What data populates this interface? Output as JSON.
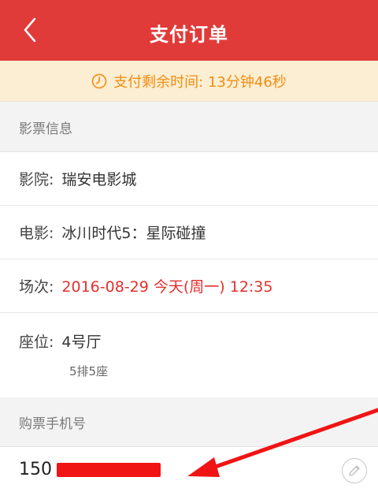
{
  "header": {
    "title": "支付订单",
    "back_icon": "chevron-left-icon"
  },
  "timer": {
    "text": "支付剩余时间: 13分钟46秒",
    "icon": "clock-icon",
    "color": "#f18d12"
  },
  "ticket_section": {
    "title": "影票信息"
  },
  "ticket": {
    "cinema_label": "影院:",
    "cinema_value": "瑞安电影城",
    "movie_label": "电影:",
    "movie_value": "冰川时代5：星际碰撞",
    "session_label": "场次:",
    "session_value": "2016-08-29 今天(周一) 12:35",
    "seat_label": "座位:",
    "seat_value": "4号厅",
    "seat_detail": "5排5座"
  },
  "phone_section": {
    "title": "购票手机号"
  },
  "phone": {
    "prefix": "150",
    "edit_icon": "pencil-icon"
  },
  "colors": {
    "header_bg": "#e03b39",
    "accent_red": "#e52f2f",
    "annotation_arrow": "#f01414"
  }
}
